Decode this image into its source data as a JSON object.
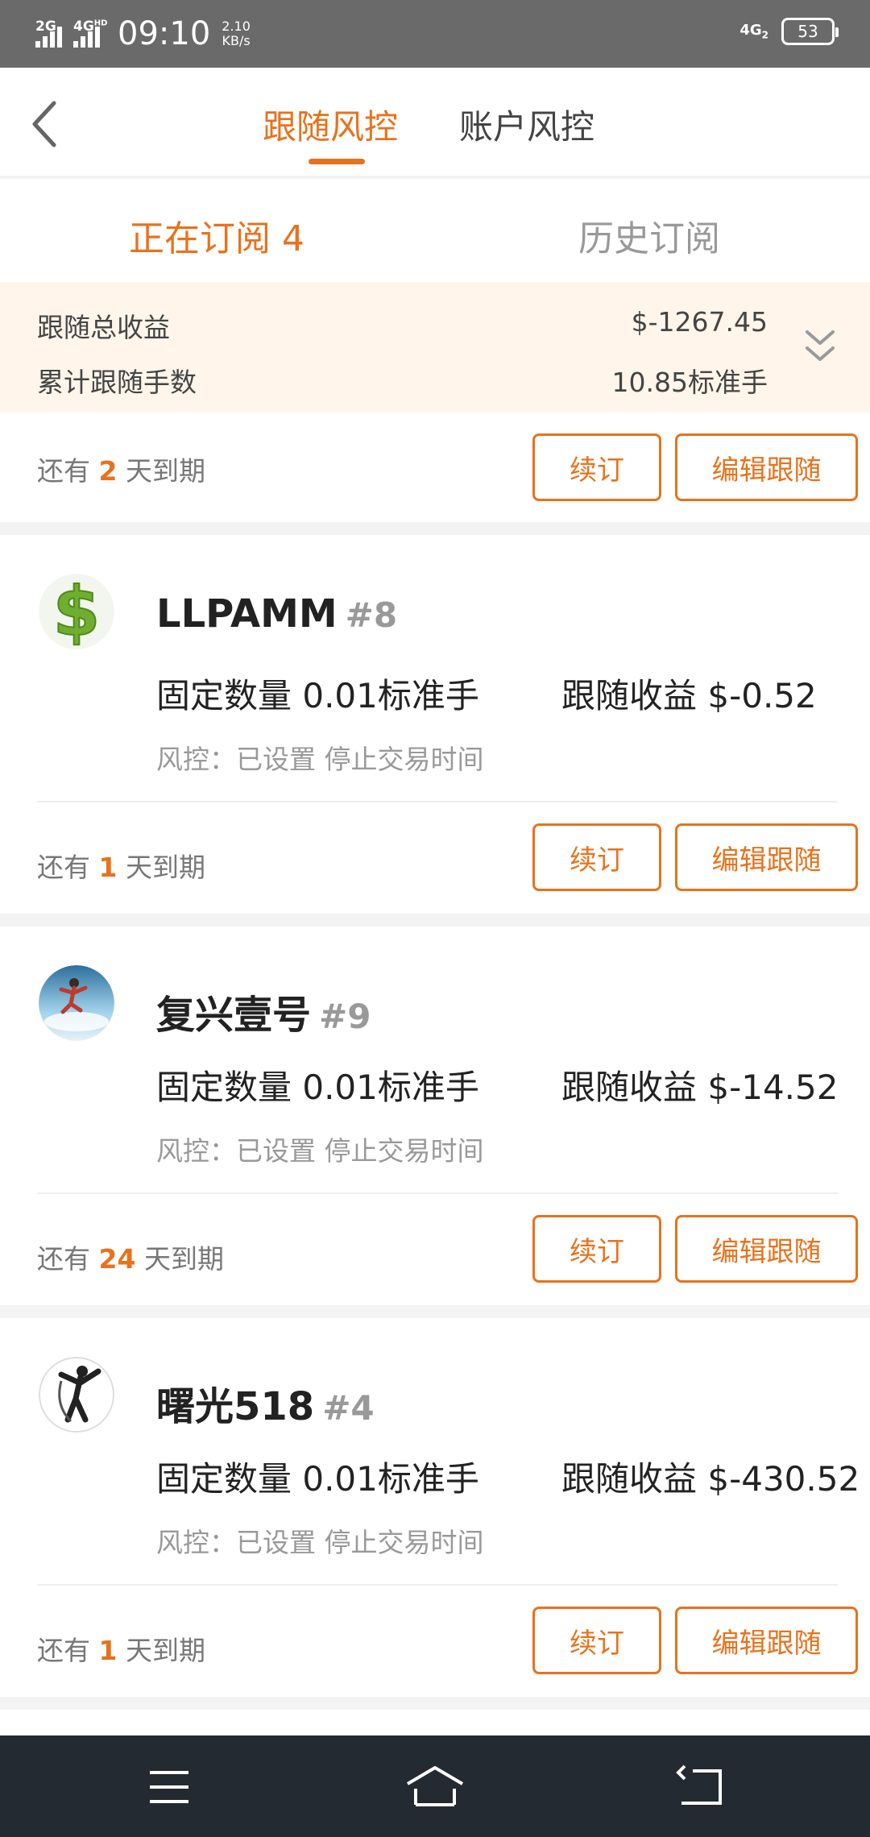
{
  "status_bar": {
    "sig1": "2G",
    "sig2": "4G",
    "sig2_sup": "HD",
    "time": "09:10",
    "speed_value": "2.10",
    "speed_unit": "KB/s",
    "net": "4G",
    "net_sub": "2",
    "battery": "53"
  },
  "header": {
    "tabs": [
      {
        "label": "跟随风控",
        "active": true
      },
      {
        "label": "账户风控",
        "active": false
      }
    ]
  },
  "subtabs": [
    {
      "label": "正在订阅 4",
      "active": true
    },
    {
      "label": "历史订阅",
      "active": false
    }
  ],
  "summary": {
    "total_profit_label": "跟随总收益",
    "total_profit_value": "$-1267.45",
    "lots_label": "累计跟随手数",
    "lots_value": "10.85标准手"
  },
  "expiry_prefix": "还有",
  "expiry_suffix": "天到期",
  "renew_label": "续订",
  "edit_label": "编辑跟随",
  "top_expiry": {
    "days": "2"
  },
  "cards": [
    {
      "name": "LLPAMM",
      "num": "#8",
      "fixed": "固定数量 0.01标准手",
      "profit": "跟随收益 $-0.52",
      "risk": "风控：已设置 停止交易时间",
      "days": "1"
    },
    {
      "name": "复兴壹号",
      "num": "#9",
      "fixed": "固定数量 0.01标准手",
      "profit": "跟随收益 $-14.52",
      "risk": "风控：已设置 停止交易时间",
      "days": "24"
    },
    {
      "name": "曙光518",
      "num": "#4",
      "fixed": "固定数量 0.01标准手",
      "profit": "跟随收益 $-430.52",
      "risk": "风控：已设置 停止交易时间",
      "days": "1"
    }
  ],
  "icons": {
    "back": "chevron-left-icon",
    "expand": "double-chevron-down-icon",
    "nav": [
      "menu-icon",
      "home-icon",
      "back-arrow-icon"
    ]
  },
  "colors": {
    "accent": "#e8721c",
    "summary_bg": "#fff5ea",
    "nav_bg": "#232a31"
  }
}
